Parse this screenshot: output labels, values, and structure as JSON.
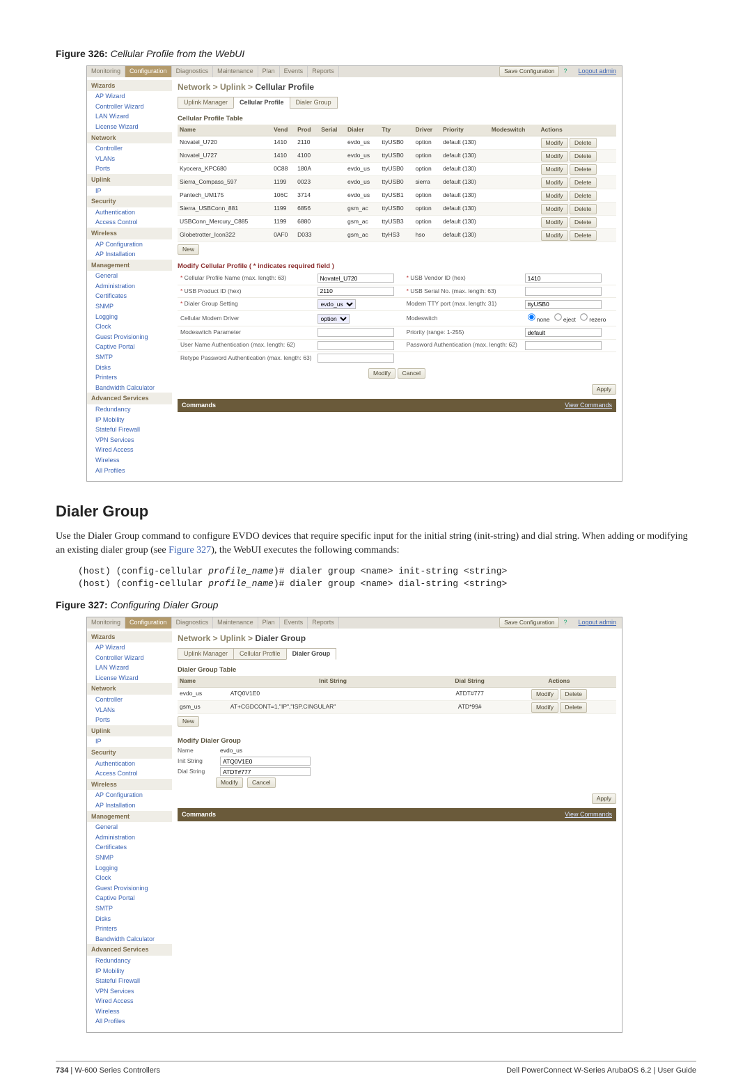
{
  "figure326": {
    "label_bold": "Figure 326:",
    "label_italic": "Cellular Profile from the WebUI"
  },
  "figure327": {
    "label_bold": "Figure 327:",
    "label_italic": "Configuring Dialer Group"
  },
  "section": {
    "heading": "Dialer Group",
    "paragraph_pre": "Use the Dialer Group command to configure EVDO devices that require specific input for the initial string (init-string) and dial string. When adding or modifying an existing dialer group (see ",
    "paragraph_link": "Figure 327",
    "paragraph_post": "), the WebUI executes the following commands:"
  },
  "code": {
    "prefix1": "(host) (config-cellular ",
    "profile": "profile_name",
    "suffix1": ")# dialer group <name> init-string <string>",
    "prefix2": "(host) (config-cellular ",
    "suffix2": ")# dialer group <name> dial-string <string>"
  },
  "tabs": [
    "Monitoring",
    "Configuration",
    "Diagnostics",
    "Maintenance",
    "Plan",
    "Events",
    "Reports"
  ],
  "tabs_active_index": 1,
  "topbar": {
    "save": "Save Configuration",
    "logout": "Logout admin"
  },
  "sidebar1": {
    "sections": [
      {
        "head": "Wizards",
        "items": [
          "AP Wizard",
          "Controller Wizard",
          "LAN Wizard",
          "License Wizard"
        ]
      },
      {
        "head": "Network",
        "items": [
          "Controller",
          "VLANs",
          "Ports"
        ]
      },
      {
        "head": "Uplink",
        "items": [
          "IP"
        ]
      },
      {
        "head": "Security",
        "items": [
          "Authentication",
          "Access Control"
        ]
      },
      {
        "head": "Wireless",
        "items": [
          "AP Configuration",
          "AP Installation"
        ]
      },
      {
        "head": "Management",
        "items": [
          "General",
          "Administration",
          "Certificates",
          "SNMP",
          "Logging",
          "Clock",
          "Guest Provisioning",
          "Captive Portal",
          "SMTP",
          "Disks",
          "Printers",
          "Bandwidth Calculator"
        ]
      },
      {
        "head": "Advanced Services",
        "items": [
          "Redundancy",
          "IP Mobility",
          "Stateful Firewall",
          "VPN Services",
          "Wired Access",
          "Wireless",
          "All Profiles"
        ]
      }
    ]
  },
  "sidebar2": {
    "sections": [
      {
        "head": "Wizards",
        "items": [
          "AP Wizard",
          "Controller Wizard",
          "LAN Wizard",
          "License Wizard"
        ]
      },
      {
        "head": "Network",
        "items": [
          "Controller",
          "VLANs",
          "Ports"
        ]
      },
      {
        "head": "Uplink",
        "items": [
          "IP"
        ]
      },
      {
        "head": "Security",
        "items": [
          "Authentication",
          "Access Control"
        ]
      },
      {
        "head": "Wireless",
        "items": [
          "AP Configuration",
          "AP Installation"
        ]
      },
      {
        "head": "Management",
        "items": [
          "General",
          "Administration",
          "Certificates",
          "SNMP",
          "Logging",
          "Clock",
          "Guest Provisioning",
          "Captive Portal",
          "SMTP",
          "Disks",
          "Printers",
          "Bandwidth Calculator"
        ]
      },
      {
        "head": "Advanced Services",
        "items": [
          "Redundancy",
          "IP Mobility",
          "Stateful Firewall",
          "VPN Services",
          "Wired Access",
          "Wireless",
          "All Profiles"
        ]
      }
    ]
  },
  "cellular": {
    "breadcrumb_pre": "Network > Uplink > ",
    "breadcrumb_last": "Cellular Profile",
    "subtabs": [
      "Uplink Manager",
      "Cellular Profile",
      "Dialer Group"
    ],
    "subtabs_active": 1,
    "table_title": "Cellular Profile Table",
    "columns": [
      "Name",
      "Vend",
      "Prod",
      "Serial",
      "Dialer",
      "Tty",
      "Driver",
      "Priority",
      "Modeswitch",
      "Actions"
    ],
    "rows": [
      {
        "name": "Novatel_U720",
        "vend": "1410",
        "prod": "2110",
        "serial": "",
        "dialer": "evdo_us",
        "tty": "ttyUSB0",
        "driver": "option",
        "priority": "default (130)",
        "modeswitch": ""
      },
      {
        "name": "Novatel_U727",
        "vend": "1410",
        "prod": "4100",
        "serial": "",
        "dialer": "evdo_us",
        "tty": "ttyUSB0",
        "driver": "option",
        "priority": "default (130)",
        "modeswitch": ""
      },
      {
        "name": "Kyocera_KPC680",
        "vend": "0C88",
        "prod": "180A",
        "serial": "",
        "dialer": "evdo_us",
        "tty": "ttyUSB0",
        "driver": "option",
        "priority": "default (130)",
        "modeswitch": ""
      },
      {
        "name": "Sierra_Compass_597",
        "vend": "1199",
        "prod": "0023",
        "serial": "",
        "dialer": "evdo_us",
        "tty": "ttyUSB0",
        "driver": "sierra",
        "priority": "default (130)",
        "modeswitch": ""
      },
      {
        "name": "Pantech_UM175",
        "vend": "106C",
        "prod": "3714",
        "serial": "",
        "dialer": "evdo_us",
        "tty": "ttyUSB1",
        "driver": "option",
        "priority": "default (130)",
        "modeswitch": ""
      },
      {
        "name": "Sierra_USBConn_881",
        "vend": "1199",
        "prod": "6856",
        "serial": "",
        "dialer": "gsm_ac",
        "tty": "ttyUSB0",
        "driver": "option",
        "priority": "default (130)",
        "modeswitch": ""
      },
      {
        "name": "USBConn_Mercury_C885",
        "vend": "1199",
        "prod": "6880",
        "serial": "",
        "dialer": "gsm_ac",
        "tty": "ttyUSB3",
        "driver": "option",
        "priority": "default (130)",
        "modeswitch": ""
      },
      {
        "name": "Globetrotter_Icon322",
        "vend": "0AF0",
        "prod": "D033",
        "serial": "",
        "dialer": "gsm_ac",
        "tty": "ttyHS3",
        "driver": "hso",
        "priority": "default (130)",
        "modeswitch": ""
      }
    ],
    "actions": {
      "modify": "Modify",
      "delete": "Delete",
      "new": "New"
    },
    "form_title": "Modify Cellular Profile ( * indicates required field )",
    "form": {
      "profile_name_label": "Cellular Profile Name (max. length: 63)",
      "profile_name_value": "Novatel_U720",
      "usb_vendor_label": "USB Vendor ID (hex)",
      "usb_vendor_value": "1410",
      "usb_product_label": "USB Product ID (hex)",
      "usb_product_value": "2110",
      "usb_serial_label": "USB Serial No. (max. length: 63)",
      "usb_serial_value": "",
      "dialer_group_label": "Dialer Group Setting",
      "dialer_group_value": "evdo_us",
      "modem_tty_label": "Modem TTY port (max. length: 31)",
      "modem_tty_value": "ttyUSB0",
      "driver_label": "Cellular Modem Driver",
      "driver_value": "option",
      "modeswitch_label": "Modeswitch",
      "radio_none": "none",
      "radio_eject": "eject",
      "radio_rezero": "rezero",
      "modeswitch_param_label": "Modeswitch Parameter",
      "modeswitch_param_value": "",
      "priority_label": "Priority (range: 1-255)",
      "priority_value": "default",
      "user_auth_label": "User Name Authentication (max. length: 62)",
      "pwd_auth_label": "Password Authentication (max. length: 62)",
      "retype_pwd_label": "Retype Password Authentication (max. length: 63)"
    },
    "buttons": {
      "modify": "Modify",
      "cancel": "Cancel",
      "apply": "Apply"
    },
    "commands": {
      "label": "Commands",
      "link": "View Commands"
    }
  },
  "dialer": {
    "breadcrumb_pre": "Network > Uplink > ",
    "breadcrumb_last": "Dialer Group",
    "subtabs": [
      "Uplink Manager",
      "Cellular Profile",
      "Dialer Group"
    ],
    "subtabs_active": 2,
    "table_title": "Dialer Group Table",
    "columns": [
      "Name",
      "Init String",
      "Dial String",
      "Actions"
    ],
    "rows": [
      {
        "name": "evdo_us",
        "init": "ATQ0V1E0",
        "dial": "ATDT#777"
      },
      {
        "name": "gsm_us",
        "init": "AT+CGDCONT=1,\"IP\",\"ISP.CINGULAR\"",
        "dial": "ATD*99#"
      }
    ],
    "actions": {
      "modify": "Modify",
      "delete": "Delete",
      "new": "New"
    },
    "form_title": "Modify Dialer Group",
    "form": {
      "name_label": "Name",
      "name_value": "evdo_us",
      "init_label": "Init String",
      "init_value": "ATQ0V1E0",
      "dial_label": "Dial String",
      "dial_value": "ATDT#777"
    },
    "buttons": {
      "modify": "Modify",
      "cancel": "Cancel",
      "apply": "Apply"
    },
    "commands": {
      "label": "Commands",
      "link": "View Commands"
    }
  },
  "footer": {
    "left_bold": "734",
    "left_rest": " | W-600 Series Controllers",
    "right": "Dell PowerConnect W-Series ArubaOS 6.2  |  User Guide"
  }
}
